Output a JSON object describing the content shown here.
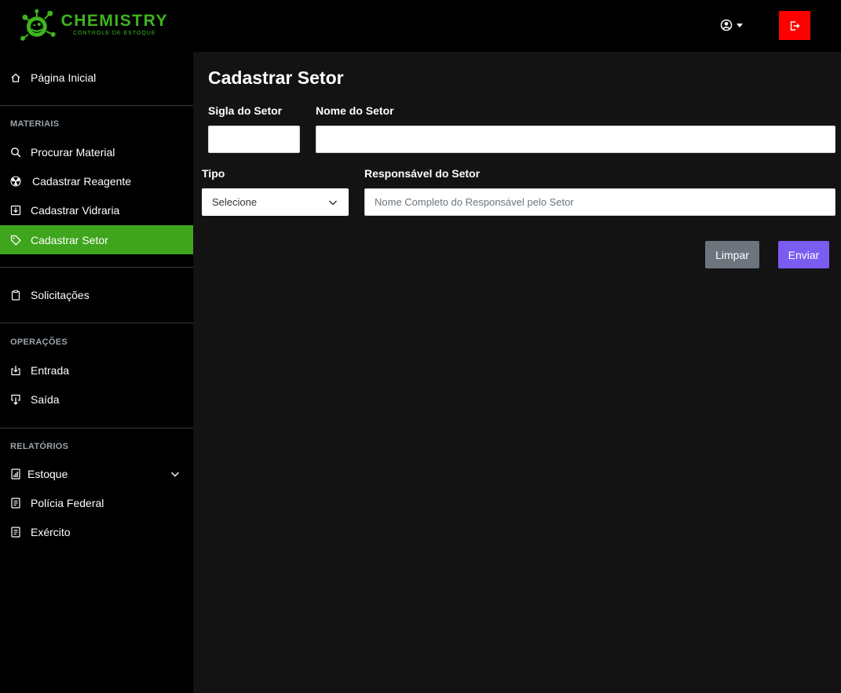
{
  "brand": {
    "title": "CHEMISTRY",
    "subtitle": "CONTROLE DE ESTOQUE",
    "accent_color": "#3fb51d"
  },
  "header": {
    "user_icon": "user-circle-icon",
    "logout_icon": "logout-icon",
    "logout_color": "#ff0000"
  },
  "sidebar": {
    "home": "Página Inicial",
    "sections": {
      "materiais": "MATERIAIS",
      "operacoes": "OPERAÇÕES",
      "relatorios": "RELATÓRIOS"
    },
    "items": {
      "procurar_material": "Procurar Material",
      "cadastrar_reagente": "Cadastrar Reagente",
      "cadastrar_vidraria": "Cadastrar Vidraria",
      "cadastrar_setor": "Cadastrar Setor",
      "solicitacoes": "Solicitações",
      "entrada": "Entrada",
      "saida": "Saída",
      "estoque": "Estoque",
      "policia_federal": "Polícia Federal",
      "exercito": "Exército"
    },
    "active_item": "cadastrar_setor",
    "active_color": "#3fa51c"
  },
  "form": {
    "title": "Cadastrar Setor",
    "sigla_label": "Sigla do Setor",
    "sigla_value": "",
    "nome_label": "Nome do Setor",
    "nome_value": "",
    "tipo_label": "Tipo",
    "tipo_selected": "Selecione",
    "responsavel_label": "Responsável do Setor",
    "responsavel_placeholder": "Nome Completo do Responsável pelo Setor",
    "clear_button": "Limpar",
    "submit_button": "Enviar",
    "submit_color": "#7b5cf0"
  }
}
